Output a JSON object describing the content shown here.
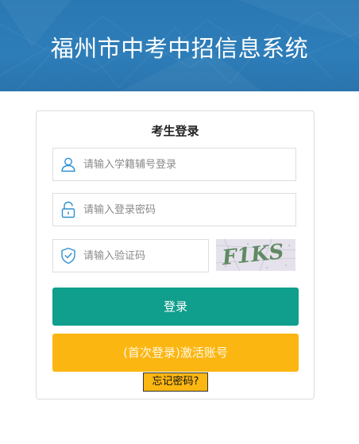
{
  "header": {
    "title": "福州市中考中招信息系统",
    "bg_color": "#2d7db9"
  },
  "login": {
    "title": "考生登录",
    "username": {
      "placeholder": "请输入学籍辅号登录",
      "value": "",
      "icon": "user-icon"
    },
    "password": {
      "placeholder": "请输入登录密码",
      "value": "",
      "icon": "lock-icon"
    },
    "captcha": {
      "placeholder": "请输入验证码",
      "value": "",
      "icon": "shield-check-icon",
      "image_text": "F1KS"
    },
    "login_button": {
      "label": "登录",
      "color": "#109e8d"
    },
    "activate_button": {
      "label": "(首次登录)激活账号",
      "color": "#fbb612"
    },
    "forgot_button": {
      "label": "忘记密码?"
    }
  }
}
